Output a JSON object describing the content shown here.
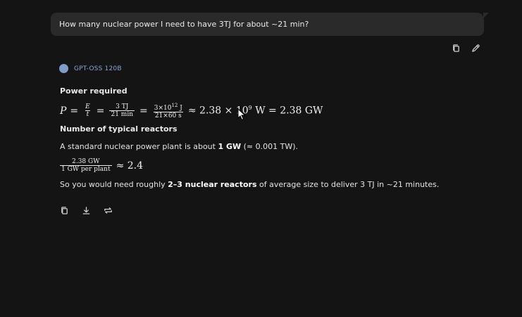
{
  "user_message": {
    "text": "How many nuclear power I need to have 3TJ for about ~21 min?",
    "actions": [
      {
        "name": "copy-icon"
      },
      {
        "name": "edit-icon"
      }
    ]
  },
  "assistant": {
    "model_name": "GPT-OSS 120B",
    "avatar_color": "#7d9cc9",
    "section1_heading": "Power required",
    "eq1": {
      "lhs": "P",
      "eq": "=",
      "f1_num": "E",
      "f1_den": "t",
      "eq2": "=",
      "f2_num": "3 TJ",
      "f2_den": "21 min",
      "eq3": "=",
      "f3_num_a": "3×10",
      "f3_num_exp": "12",
      "f3_num_b": " J",
      "f3_den": "21×60 s",
      "approx_a": "≈ 2.38 × 10",
      "approx_exp": "9",
      "approx_b": " W = 2.38 GW"
    },
    "section2_heading": "Number of typical reactors",
    "para1_a": "A standard nuclear power plant is about ",
    "para1_bold": "1 GW",
    "para1_b": " (≈ 0.001 TW).",
    "eq2": {
      "num": "2.38 GW",
      "den": "1 GW per plant",
      "approx": "≈ 2.4"
    },
    "para2_a": "So you would need roughly ",
    "para2_bold": "2–3 nuclear reactors",
    "para2_b": " of average size to deliver 3 TJ in ~21 minutes.",
    "actions": [
      {
        "name": "copy-icon"
      },
      {
        "name": "download-icon"
      },
      {
        "name": "regenerate-icon"
      }
    ]
  },
  "colors": {
    "background": "#141414",
    "bubble": "#2a2a2a",
    "model_label": "#8ea6cf"
  }
}
